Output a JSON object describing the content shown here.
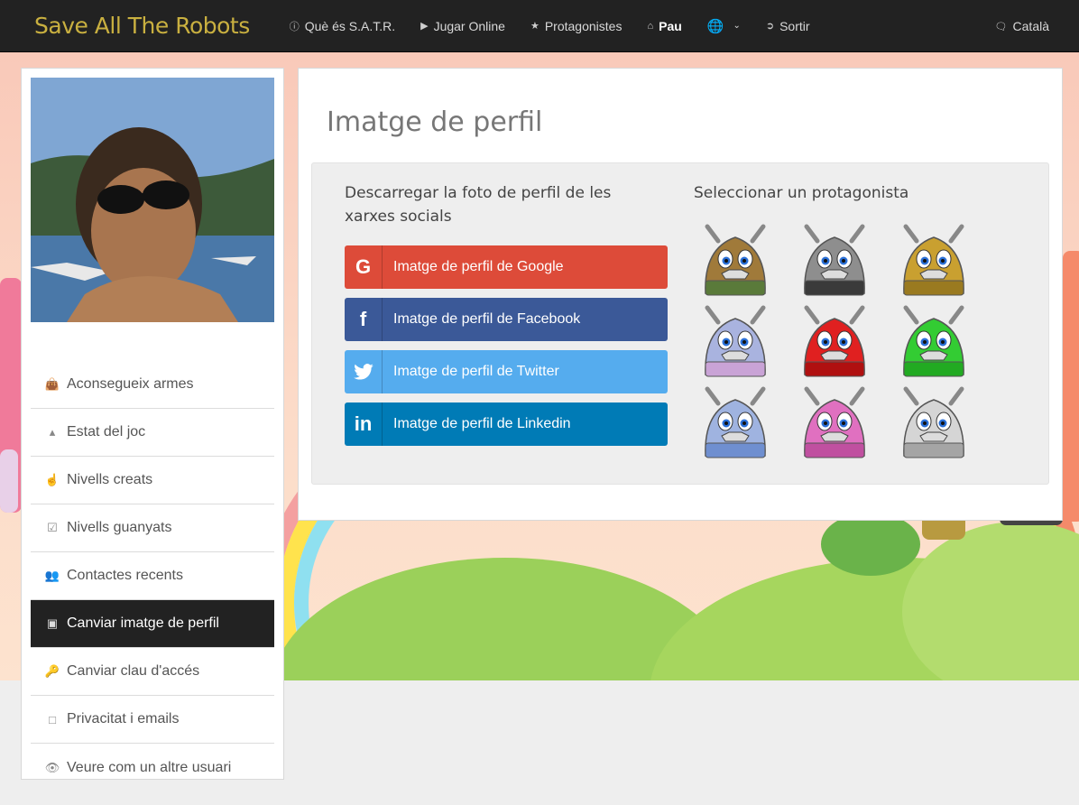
{
  "navbar": {
    "brand": "Save All The Robots",
    "items": [
      {
        "label": "Què és S.A.T.R.",
        "icon": "info-icon"
      },
      {
        "label": "Jugar Online",
        "icon": "play-icon"
      },
      {
        "label": "Protagonistes",
        "icon": "star-icon"
      },
      {
        "label": "Pau",
        "icon": "home-icon"
      },
      {
        "label": "",
        "icon": "globe-icon"
      },
      {
        "label": "Sortir",
        "icon": "logout-icon"
      }
    ],
    "language": "Català"
  },
  "sidebar": {
    "items": [
      {
        "label": "Aconsegueix armes",
        "icon": "shopping-bag-icon"
      },
      {
        "label": "Estat del joc",
        "icon": "area-chart-icon"
      },
      {
        "label": "Nivells creats",
        "icon": "hand-pointer-icon"
      },
      {
        "label": "Nivells guanyats",
        "icon": "check-square-icon"
      },
      {
        "label": "Contactes recents",
        "icon": "users-icon"
      },
      {
        "label": "Canviar imatge de perfil",
        "icon": "image-icon",
        "active": true
      },
      {
        "label": "Canviar clau d'accés",
        "icon": "key-icon"
      },
      {
        "label": "Privacitat i emails",
        "icon": "sticky-note-icon"
      },
      {
        "label": "Veure com un altre usuari",
        "icon": "eye-slash-icon"
      }
    ]
  },
  "main": {
    "title": "Imatge de perfil",
    "social_title": "Descarregar la foto de perfil de les xarxes socials",
    "social_buttons": [
      {
        "label": "Imatge de perfil de Google",
        "icon": "google-icon",
        "color": "#dd4b39"
      },
      {
        "label": "Imatge de perfil de Facebook",
        "icon": "facebook-icon",
        "color": "#3b5998"
      },
      {
        "label": "Imatge de perfil de Twitter",
        "icon": "twitter-icon",
        "color": "#55acee"
      },
      {
        "label": "Imatge de perfil de Linkedin",
        "icon": "linkedin-icon",
        "color": "#007bb6"
      }
    ],
    "robots_title": "Seleccionar un protagonista",
    "robots": [
      {
        "name": "robot-olive",
        "color": "#a07a3a",
        "base": "#5a7a3a"
      },
      {
        "name": "robot-grey",
        "color": "#8e8e8e",
        "base": "#3a3a3a"
      },
      {
        "name": "robot-gold",
        "color": "#c9a030",
        "base": "#9a7a20"
      },
      {
        "name": "robot-lilac",
        "color": "#a9b3df",
        "base": "#c9a3d6"
      },
      {
        "name": "robot-red",
        "color": "#e02020",
        "base": "#b01010"
      },
      {
        "name": "robot-green",
        "color": "#33cc33",
        "base": "#22aa22"
      },
      {
        "name": "robot-blue",
        "color": "#9fb3e0",
        "base": "#6f8fd0"
      },
      {
        "name": "robot-pink",
        "color": "#e070c0",
        "base": "#c050a0"
      },
      {
        "name": "robot-white",
        "color": "#d5d5d5",
        "base": "#a5a5a5"
      }
    ]
  }
}
